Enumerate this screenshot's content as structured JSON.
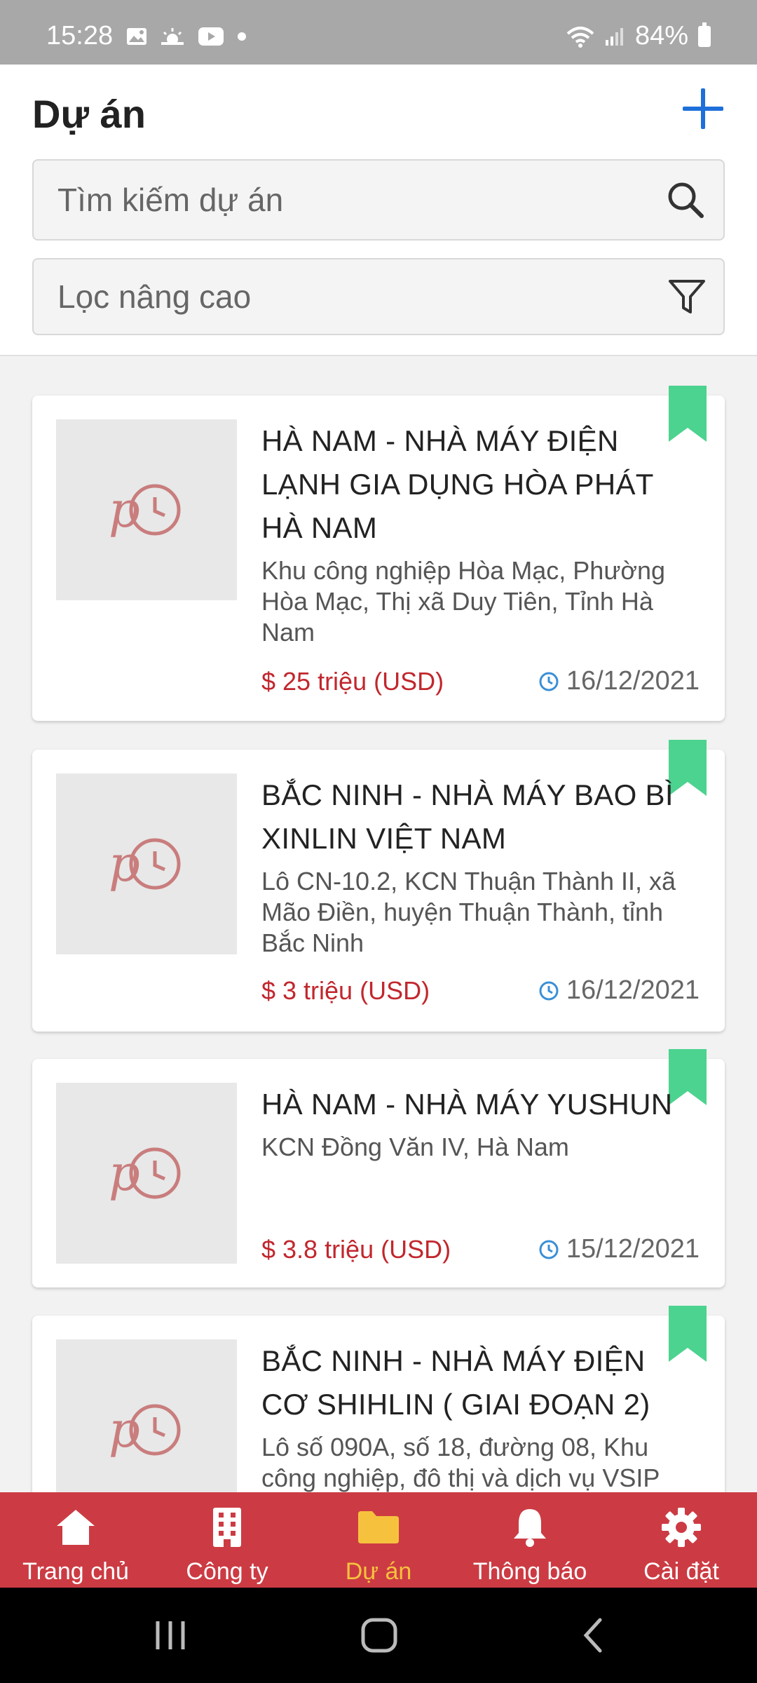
{
  "status_bar": {
    "time": "15:28",
    "battery": "84%",
    "icons": [
      "image-icon",
      "weather-icon",
      "youtube-icon",
      "dot-icon"
    ]
  },
  "header": {
    "title": "Dự án",
    "search_placeholder": "Tìm kiếm dự án",
    "filter_label": "Lọc nâng cao"
  },
  "colors": {
    "accent": "#1e6fd9",
    "nav_background": "#cc3b43",
    "nav_active": "#f6c23e",
    "price": "#c1272d",
    "bookmark": "#4cd38f"
  },
  "projects": [
    {
      "title": "HÀ NAM - NHÀ MÁY ĐIỆN LẠNH GIA DỤNG HÒA PHÁT HÀ NAM",
      "address": "Khu công nghiệp Hòa Mạc, Phường Hòa Mạc, Thị xã Duy Tiên, Tỉnh Hà Nam",
      "price": "$ 25 triệu (USD)",
      "date": "16/12/2021"
    },
    {
      "title": "BẮC NINH - NHÀ MÁY BAO BÌ XINLIN VIỆT NAM",
      "address": "Lô CN-10.2, KCN Thuận Thành II, xã Mão Điền, huyện Thuận Thành, tỉnh Bắc Ninh",
      "price": "$ 3 triệu (USD)",
      "date": "16/12/2021"
    },
    {
      "title": "HÀ NAM - NHÀ MÁY YUSHUN",
      "address": "KCN Đồng Văn IV, Hà Nam",
      "price": "$ 3.8 triệu (USD)",
      "date": "15/12/2021"
    },
    {
      "title": "BẮC NINH - NHÀ MÁY ĐIỆN CƠ SHIHLIN ( GIAI ĐOẠN 2)",
      "address": "Lô số 090A, số 18, đường 08, Khu công nghiệp, đô thị và dịch vụ VSIP",
      "price": "",
      "date": ""
    }
  ],
  "bottom_nav": [
    {
      "label": "Trang chủ",
      "icon": "home-icon",
      "active": false
    },
    {
      "label": "Công ty",
      "icon": "building-icon",
      "active": false
    },
    {
      "label": "Dự án",
      "icon": "folder-icon",
      "active": true
    },
    {
      "label": "Thông báo",
      "icon": "bell-icon",
      "active": false
    },
    {
      "label": "Cài đặt",
      "icon": "gear-icon",
      "active": false
    }
  ]
}
